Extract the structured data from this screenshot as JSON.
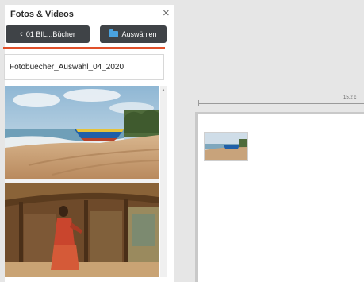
{
  "panel": {
    "title": "Fotos & Videos",
    "close_icon": "close-icon",
    "back_button_label": "01 BIL...Bücher",
    "select_button_label": "Auswählen",
    "album_name": "Fotobuecher_Auswahl_04_2020",
    "accent_color": "#e0502a",
    "button_color": "#3f4347"
  },
  "photos": [
    {
      "name": "beach-boat-photo"
    },
    {
      "name": "hut-woman-photo"
    }
  ],
  "workspace": {
    "ruler_label": "15,2 c"
  }
}
